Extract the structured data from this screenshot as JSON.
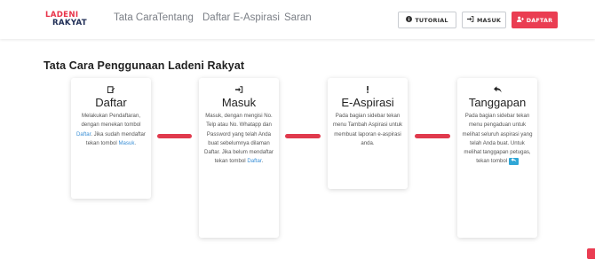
{
  "brand": {
    "line1": "LADENI",
    "line2": "RAKYAT"
  },
  "nav": {
    "links": [
      "Tata Cara",
      "Tentang",
      "Daftar E-Aspirasi",
      "Saran"
    ],
    "buttons": {
      "tutorial": {
        "label": "TUTORIAL",
        "icon": "info-circle-icon"
      },
      "masuk": {
        "label": "MASUK",
        "icon": "sign-in-icon"
      },
      "daftar": {
        "label": "DAFTAR",
        "icon": "user-plus-icon"
      }
    }
  },
  "page_title": "Tata Cara Penggunaan Ladeni Rakyat",
  "steps": [
    {
      "icon": "register-icon",
      "title": "Daftar",
      "text_before": "Melakukan Pendaftaran, dengan menekan tombol",
      "link1": "Daftar",
      "text_middle": ". Jika sudah mendaftar tekan tombol",
      "link2": "Masuk",
      "text_after": "."
    },
    {
      "icon": "sign-in-icon",
      "title": "Masuk",
      "text_before": "Masuk, dengan mengisi No. Telp atau No. Whatapp dan Password yang telah Anda buat sebelumnya dilaman Daftar. Jika belum mendaftar tekan tombol",
      "link1": "Daftar",
      "text_after": "."
    },
    {
      "icon": "exclamation-icon",
      "title": "E-Aspirasi",
      "text": "Pada bagian sidebar tekan menu Tambah Aspirasi untuk membuat laporan e-aspirasi anda."
    },
    {
      "icon": "reply-icon",
      "title": "Tanggapan",
      "text": "Pada bagian sidebar tekan menu pengaduan untuk melihat seluruh aspirasi yang telah Anda buat. Untuk melihat tanggapan petugas, tekan tombol",
      "inline_button_icon": "reply-icon"
    }
  ],
  "colors": {
    "accent_red": "#e8344a",
    "brand_navy": "#1f2d55",
    "link_blue": "#3a8fd6"
  }
}
